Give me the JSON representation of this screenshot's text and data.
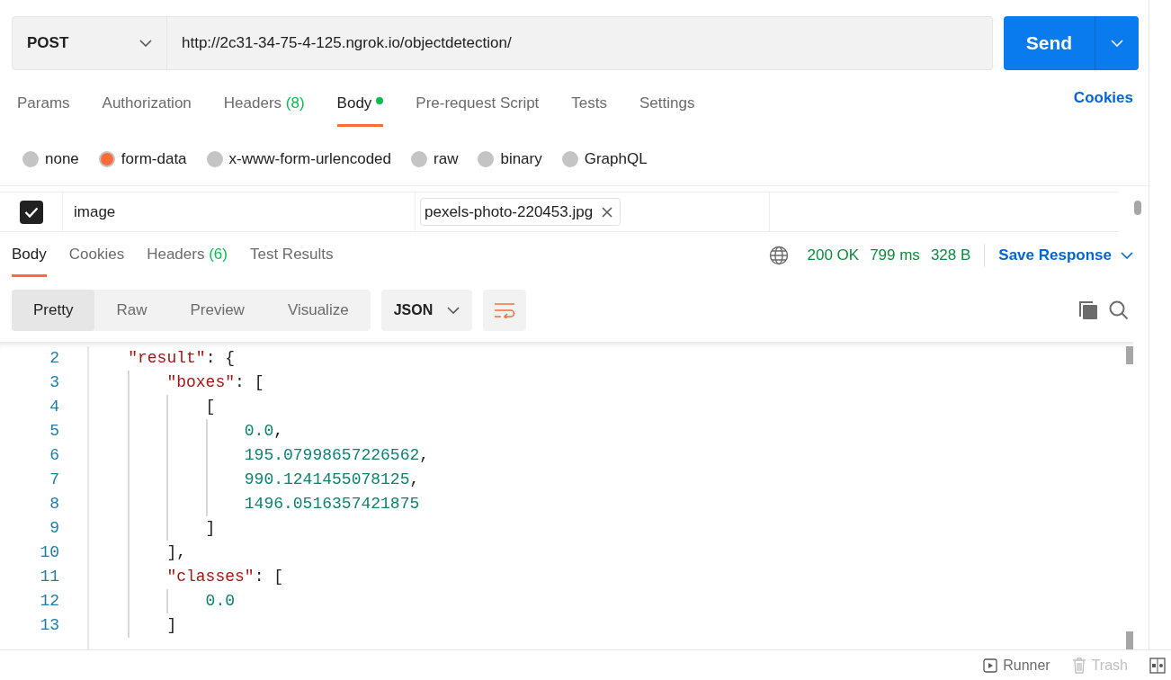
{
  "request": {
    "method": "POST",
    "url": "http://2c31-34-75-4-125.ngrok.io/objectdetection/",
    "send_label": "Send"
  },
  "request_tabs": [
    {
      "label": "Params",
      "selected": false
    },
    {
      "label": "Authorization",
      "selected": false
    },
    {
      "label": "Headers",
      "count": "(8)",
      "selected": false
    },
    {
      "label": "Body",
      "selected": true,
      "dot": true
    },
    {
      "label": "Pre-request Script",
      "selected": false
    },
    {
      "label": "Tests",
      "selected": false
    },
    {
      "label": "Settings",
      "selected": false
    }
  ],
  "cookies_link": "Cookies",
  "body_types": [
    {
      "label": "none",
      "selected": false
    },
    {
      "label": "form-data",
      "selected": true
    },
    {
      "label": "x-www-form-urlencoded",
      "selected": false
    },
    {
      "label": "raw",
      "selected": false
    },
    {
      "label": "binary",
      "selected": false
    },
    {
      "label": "GraphQL",
      "selected": false
    }
  ],
  "form_rows": [
    {
      "checked": true,
      "key": "image",
      "file": "pexels-photo-220453.jpg"
    }
  ],
  "response_tabs": [
    {
      "label": "Body",
      "selected": true
    },
    {
      "label": "Cookies",
      "selected": false
    },
    {
      "label": "Headers",
      "count": "(6)",
      "selected": false
    },
    {
      "label": "Test Results",
      "selected": false
    }
  ],
  "response_status": {
    "status": "200 OK",
    "time": "799 ms",
    "size": "328 B"
  },
  "save_response": "Save Response",
  "view_modes": [
    {
      "label": "Pretty",
      "selected": true
    },
    {
      "label": "Raw",
      "selected": false
    },
    {
      "label": "Preview",
      "selected": false
    },
    {
      "label": "Visualize",
      "selected": false
    }
  ],
  "format": "JSON",
  "code_lines": [
    {
      "number": "2",
      "tokens": [
        {
          "kind": "key",
          "text": "\"result\""
        },
        {
          "kind": "punct",
          "text": ": {"
        }
      ],
      "children": [
        {
          "number": "3",
          "tokens": [
            {
              "kind": "key",
              "text": "\"boxes\""
            },
            {
              "kind": "punct",
              "text": ": ["
            }
          ],
          "children": [
            {
              "number": "4",
              "tokens": [
                {
                  "kind": "punct",
                  "text": "["
                }
              ],
              "children": [
                {
                  "number": "5",
                  "tokens": [
                    {
                      "kind": "number",
                      "text": "0.0"
                    },
                    {
                      "kind": "punct",
                      "text": ","
                    }
                  ]
                },
                {
                  "number": "6",
                  "tokens": [
                    {
                      "kind": "number",
                      "text": "195.07998657226562"
                    },
                    {
                      "kind": "punct",
                      "text": ","
                    }
                  ]
                },
                {
                  "number": "7",
                  "tokens": [
                    {
                      "kind": "number",
                      "text": "990.1241455078125"
                    },
                    {
                      "kind": "punct",
                      "text": ","
                    }
                  ]
                },
                {
                  "number": "8",
                  "tokens": [
                    {
                      "kind": "number",
                      "text": "1496.0516357421875"
                    }
                  ]
                }
              ]
            },
            {
              "number": "9",
              "tokens": [
                {
                  "kind": "punct",
                  "text": "]"
                }
              ]
            }
          ]
        },
        {
          "number": "10",
          "tokens": [
            {
              "kind": "punct",
              "text": "],"
            }
          ]
        },
        {
          "number": "11",
          "tokens": [
            {
              "kind": "key",
              "text": "\"classes\""
            },
            {
              "kind": "punct",
              "text": ": ["
            }
          ],
          "children": [
            {
              "number": "12",
              "tokens": [
                {
                  "kind": "number",
                  "text": "0.0"
                }
              ]
            }
          ]
        },
        {
          "number": "13",
          "tokens": [
            {
              "kind": "punct",
              "text": "]"
            }
          ]
        }
      ]
    }
  ],
  "footer": [
    {
      "kind": "runner",
      "label": "Runner",
      "disabled": false
    },
    {
      "kind": "trash",
      "label": "Trash",
      "disabled": true
    }
  ]
}
